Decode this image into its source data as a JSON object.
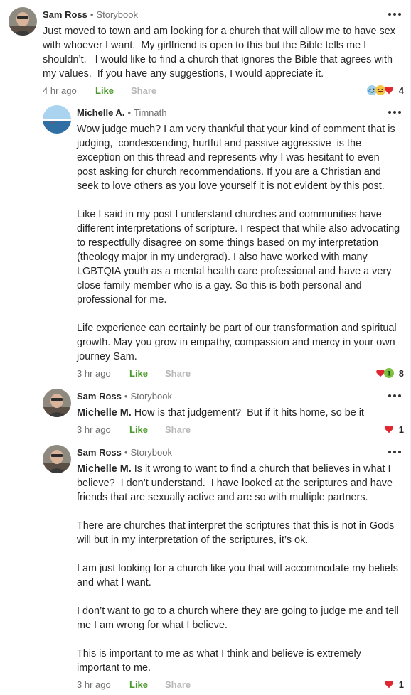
{
  "comments": [
    {
      "author": "Sam Ross",
      "separator": "•",
      "location": "Storybook",
      "mention": "",
      "paragraphs": [
        "Just moved to town and am looking for a church that will allow me to have sex with whoever I want.  My girlfriend is open to this but the Bible tells me I shouldn’t.   I would like to find a church that ignores the Bible that agrees with my values.  If you have any suggestions, I would appreciate it."
      ],
      "time": "4 hr ago",
      "like_label": "Like",
      "share_label": "Share",
      "reactions": [
        "crying-laughing-icon",
        "laughing-icon",
        "heart-icon"
      ],
      "reaction_count": "4"
    },
    {
      "author": "Michelle A.",
      "separator": "•",
      "location": "Timnath",
      "mention": "",
      "paragraphs": [
        "Wow judge much? I am very thankful that your kind of comment that is judging,  condescending, hurtful and passive aggressive  is the exception on this thread and represents why I was hesitant to even post asking for church recommendations. If you are a Christian and seek to love others as you love yourself it is not evident by this post.",
        "Like I said in my post I understand churches and communities have different interpretations of scripture. I respect that while also advocating  to respectfully disagree on some things based on my interpretation (theology major in my undergrad). I also have worked with many LGBTQIA youth as a mental health care professional and have a very close family member who is a gay. So this is both personal and professional for me.",
        "Life experience can certainly be part of our transformation and spiritual growth. May you grow in empathy, compassion and mercy in your own journey Sam."
      ],
      "time": "3 hr ago",
      "like_label": "Like",
      "share_label": "Share",
      "reactions": [
        "heart-icon",
        "plus-one-icon"
      ],
      "reaction_count": "8"
    },
    {
      "author": "Sam Ross",
      "separator": "•",
      "location": "Storybook",
      "mention": "Michelle M.",
      "paragraphs": [
        "How is that judgement?  But if it hits home, so be it"
      ],
      "time": "3 hr ago",
      "like_label": "Like",
      "share_label": "Share",
      "reactions": [
        "heart-icon"
      ],
      "reaction_count": "1"
    },
    {
      "author": "Sam Ross",
      "separator": "•",
      "location": "Storybook",
      "mention": "Michelle M.",
      "paragraphs": [
        "Is it wrong to want to find a church that believes in what I believe?  I don’t understand.  I have looked at the scriptures and have friends that are sexually active and are so with multiple partners.",
        "There are churches that interpret the scriptures that this is not in Gods will but in my interpretation of the scriptures, it’s ok.",
        "I am just looking for a church like you that will accommodate my beliefs and what I want.",
        "I don’t want to go to a church where they are going to judge me and tell me I am wrong for what I believe.",
        "This is important to me as what I think and believe is extremely important to me."
      ],
      "time": "3 hr ago",
      "like_label": "Like",
      "share_label": "Share",
      "reactions": [
        "heart-icon"
      ],
      "reaction_count": "1"
    }
  ],
  "colors": {
    "like": "#4a9a2c",
    "muted": "#6f6f6f",
    "share": "#b7b7b7",
    "heart": "#e0262f"
  }
}
